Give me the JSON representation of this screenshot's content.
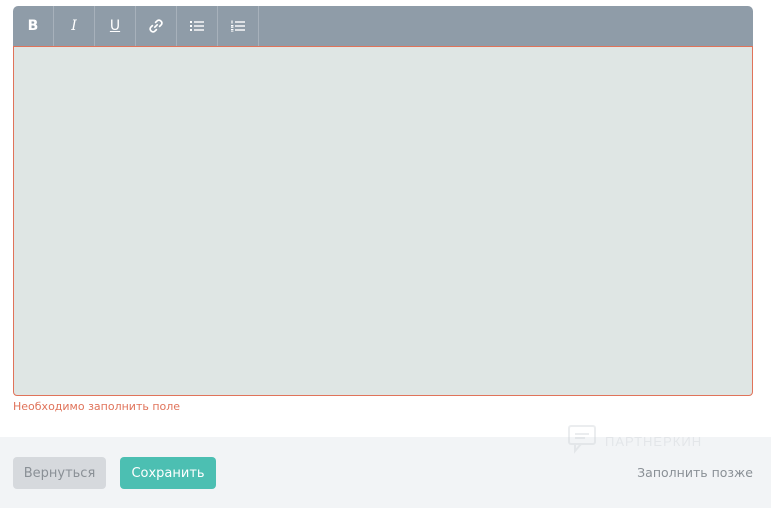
{
  "editor": {
    "toolbar": {
      "bold": "B",
      "italic": "I",
      "underline": "U",
      "link_icon": "link-icon",
      "bullet_list_icon": "bullet-list-icon",
      "numbered_list_icon": "numbered-list-icon"
    },
    "value": "",
    "error": "Необходимо заполнить поле"
  },
  "footer": {
    "back_label": "Вернуться",
    "save_label": "Сохранить",
    "later_label": "Заполнить позже"
  },
  "watermark": {
    "text": "ПАРТНЕРКИН"
  },
  "colors": {
    "toolbar": "#8f9ca8",
    "textarea_bg": "#dfe6e4",
    "error": "#e0735a",
    "save": "#4cbfb2",
    "back": "#d6d9dd",
    "footer_bg": "#f2f4f6"
  }
}
